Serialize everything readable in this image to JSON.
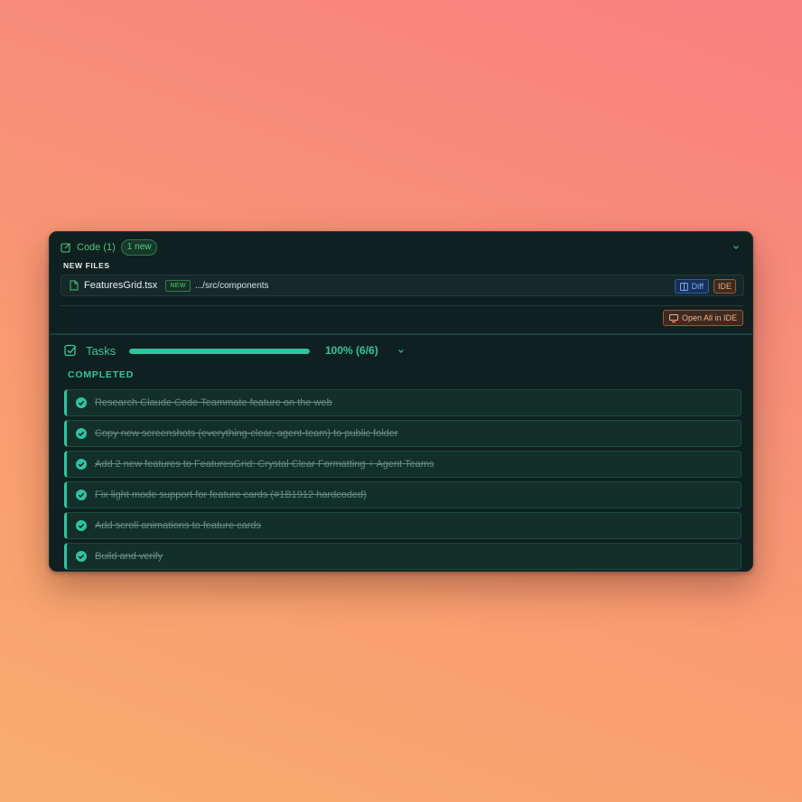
{
  "code": {
    "title": "Code (1)",
    "badge": "1 new",
    "section_label": "NEW FILES",
    "files": [
      {
        "name": "FeaturesGrid.tsx",
        "tag": "NEW",
        "path": ".../src/components",
        "diff_label": "Diff",
        "ide_label": "IDE"
      }
    ],
    "open_all_label": "Open All in IDE"
  },
  "tasks": {
    "title": "Tasks",
    "progress": 1.0,
    "progress_text": "100% (6/6)",
    "section_label": "COMPLETED",
    "items": [
      {
        "label": "Research Claude Code Teammate feature on the web",
        "done": true
      },
      {
        "label": "Copy new screenshots (everything-clear, agent-team) to public folder",
        "done": true
      },
      {
        "label": "Add 2 new features to FeaturesGrid: Crystal Clear Formatting + Agent Teams",
        "done": true
      },
      {
        "label": "Fix light mode support for feature cards (#1B1912 hardcoded)",
        "done": true
      },
      {
        "label": "Add scroll animations to feature cards",
        "done": true
      },
      {
        "label": "Build and verify",
        "done": true
      }
    ]
  },
  "colors": {
    "accent_teal": "#2ec4a0",
    "accent_green": "#4ec47a",
    "panel_bg": "#0f2020",
    "diff_blue": "#7eaaf0",
    "ide_orange": "#f0a876"
  },
  "icons": {
    "code": "edit-square-icon",
    "file": "file-icon",
    "diff": "columns-icon",
    "open_all": "monitor-icon",
    "tasks": "checkbox-icon",
    "task_done": "check-circle-icon",
    "collapse": "chevron-down-icon"
  }
}
